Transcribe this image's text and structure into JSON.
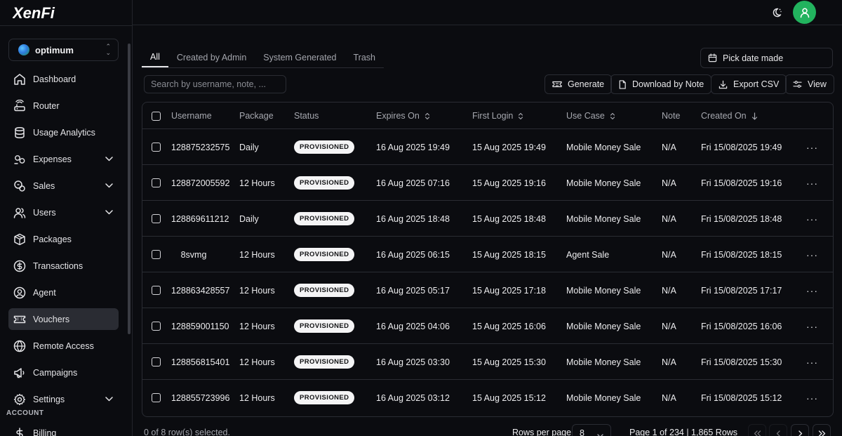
{
  "app": {
    "logo_text": "XenFi"
  },
  "org": {
    "name": "optimum"
  },
  "sidebar": {
    "items": [
      {
        "label": "Dashboard",
        "icon": "home-icon",
        "chevron": false,
        "active": false
      },
      {
        "label": "Router",
        "icon": "router-icon",
        "chevron": false,
        "active": false
      },
      {
        "label": "Usage Analytics",
        "icon": "database-icon",
        "chevron": false,
        "active": false
      },
      {
        "label": "Expenses",
        "icon": "coins-icon",
        "chevron": true,
        "active": false
      },
      {
        "label": "Sales",
        "icon": "sales-icon",
        "chevron": true,
        "active": false
      },
      {
        "label": "Users",
        "icon": "users-icon",
        "chevron": true,
        "active": false
      },
      {
        "label": "Packages",
        "icon": "package-icon",
        "chevron": false,
        "active": false
      },
      {
        "label": "Transactions",
        "icon": "dollar-circle-icon",
        "chevron": false,
        "active": false
      },
      {
        "label": "Agent",
        "icon": "user-circle-icon",
        "chevron": false,
        "active": false
      },
      {
        "label": "Vouchers",
        "icon": "ticket-icon",
        "chevron": false,
        "active": true
      },
      {
        "label": "Remote Access",
        "icon": "globe-icon",
        "chevron": false,
        "active": false
      },
      {
        "label": "Campaigns",
        "icon": "megaphone-icon",
        "chevron": false,
        "active": false
      },
      {
        "label": "Settings",
        "icon": "gear-icon",
        "chevron": true,
        "active": false
      }
    ],
    "account_section": "ACCOUNT",
    "billing_label": "Billing"
  },
  "tabs": [
    {
      "label": "All",
      "active": true
    },
    {
      "label": "Created by Admin",
      "active": false
    },
    {
      "label": "System Generated",
      "active": false
    },
    {
      "label": "Trash",
      "active": false
    }
  ],
  "date_picker": {
    "label": "Pick date made"
  },
  "search": {
    "placeholder": "Search by username, note, ..."
  },
  "toolbar": {
    "generate_label": "Generate",
    "download_label": "Download by Note",
    "export_label": "Export CSV",
    "view_label": "View"
  },
  "table": {
    "columns": {
      "username": "Username",
      "package": "Package",
      "status": "Status",
      "expires_on": "Expires On",
      "first_login": "First Login",
      "use_case": "Use Case",
      "note": "Note",
      "created_on": "Created On"
    },
    "rows": [
      {
        "username": "128875232575",
        "package": "Daily",
        "status": "PROVISIONED",
        "expires_on": "16 Aug 2025 19:49",
        "first_login": "15 Aug 2025 19:49",
        "use_case": "Mobile Money Sale",
        "note": "N/A",
        "created_on": "Fri 15/08/2025 19:49"
      },
      {
        "username": "128872005592",
        "package": "12 Hours",
        "status": "PROVISIONED",
        "expires_on": "16 Aug 2025 07:16",
        "first_login": "15 Aug 2025 19:16",
        "use_case": "Mobile Money Sale",
        "note": "N/A",
        "created_on": "Fri 15/08/2025 19:16"
      },
      {
        "username": "128869611212",
        "package": "Daily",
        "status": "PROVISIONED",
        "expires_on": "16 Aug 2025 18:48",
        "first_login": "15 Aug 2025 18:48",
        "use_case": "Mobile Money Sale",
        "note": "N/A",
        "created_on": "Fri 15/08/2025 18:48"
      },
      {
        "username": "8svmg",
        "package": "12 Hours",
        "status": "PROVISIONED",
        "expires_on": "16 Aug 2025 06:15",
        "first_login": "15 Aug 2025 18:15",
        "use_case": "Agent Sale",
        "note": "N/A",
        "created_on": "Fri 15/08/2025 18:15"
      },
      {
        "username": "128863428557",
        "package": "12 Hours",
        "status": "PROVISIONED",
        "expires_on": "16 Aug 2025 05:17",
        "first_login": "15 Aug 2025 17:18",
        "use_case": "Mobile Money Sale",
        "note": "N/A",
        "created_on": "Fri 15/08/2025 17:17"
      },
      {
        "username": "128859001150",
        "package": "12 Hours",
        "status": "PROVISIONED",
        "expires_on": "16 Aug 2025 04:06",
        "first_login": "15 Aug 2025 16:06",
        "use_case": "Mobile Money Sale",
        "note": "N/A",
        "created_on": "Fri 15/08/2025 16:06"
      },
      {
        "username": "128856815401",
        "package": "12 Hours",
        "status": "PROVISIONED",
        "expires_on": "16 Aug 2025 03:30",
        "first_login": "15 Aug 2025 15:30",
        "use_case": "Mobile Money Sale",
        "note": "N/A",
        "created_on": "Fri 15/08/2025 15:30"
      },
      {
        "username": "128855723996",
        "package": "12 Hours",
        "status": "PROVISIONED",
        "expires_on": "16 Aug 2025 03:12",
        "first_login": "15 Aug 2025 15:12",
        "use_case": "Mobile Money Sale",
        "note": "N/A",
        "created_on": "Fri 15/08/2025 15:12"
      }
    ]
  },
  "footer": {
    "selected_text": "0 of 8 row(s) selected.",
    "rows_per_page_label": "Rows per page",
    "rows_per_page_value": "8",
    "page_info": "Page 1 of 234 | 1,865 Rows"
  },
  "colors": {
    "background": "#0b0c10",
    "border": "#2a2c33",
    "avatar": "#22b35e",
    "badge_bg": "#f4f4f5"
  }
}
